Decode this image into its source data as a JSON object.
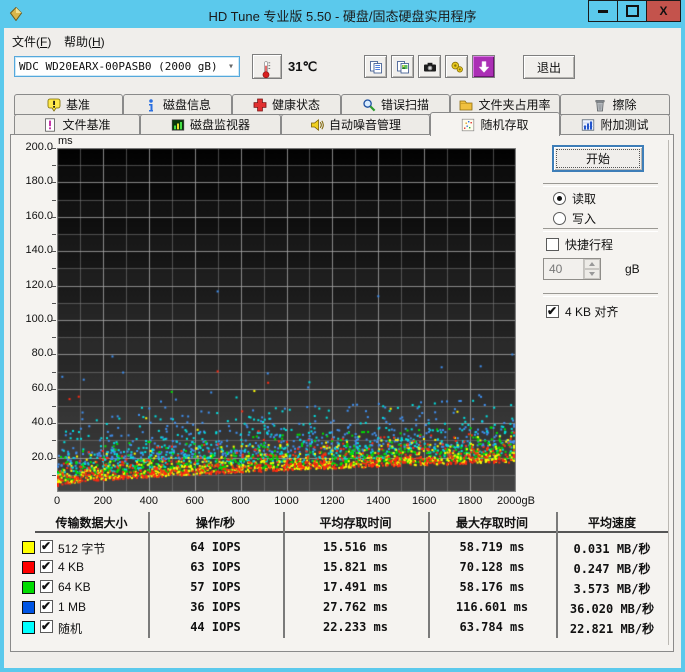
{
  "window": {
    "title": "HD Tune 专业版 5.50 - 硬盘/固态硬盘实用程序",
    "close_label": "X"
  },
  "menu": {
    "items": [
      {
        "label": "文件(F)"
      },
      {
        "label": "帮助(H)"
      }
    ]
  },
  "toolbar": {
    "drive": "WDC WD20EARX-00PASB0  (2000 gB)",
    "temperature": "31℃",
    "exit": "退出"
  },
  "tabs": {
    "row1": [
      {
        "label": "基准"
      },
      {
        "label": "磁盘信息"
      },
      {
        "label": "健康状态"
      },
      {
        "label": "错误扫描"
      },
      {
        "label": "文件夹占用率"
      },
      {
        "label": "擦除"
      }
    ],
    "row2": [
      {
        "label": "文件基准"
      },
      {
        "label": "磁盘监视器"
      },
      {
        "label": "自动噪音管理"
      },
      {
        "label": "随机存取"
      },
      {
        "label": "附加测试"
      }
    ],
    "active": "随机存取"
  },
  "panel": {
    "start": "开始",
    "read": "读取",
    "write": "写入",
    "read_selected": true,
    "write_selected": false,
    "short_stroke": "快捷行程",
    "short_stroke_checked": false,
    "short_stroke_value": "40",
    "short_stroke_unit": "gB",
    "align": "4 KB 对齐",
    "align_checked": true
  },
  "chart_data": {
    "type": "scatter",
    "ylabel": "ms",
    "x_axis_unit": "gB",
    "xlim": [
      0,
      2000
    ],
    "ylim": [
      0,
      200
    ],
    "x_label_step": 200,
    "x_grid_step": 100,
    "y_label_step": 20,
    "y_grid_step": 10,
    "grid": true,
    "background": "black-gradient",
    "envelope": {
      "base": 3.0,
      "rise": 14.0,
      "power": 0.62
    },
    "series": [
      {
        "name": "512 字节",
        "color": "#FFFF00",
        "z": 4,
        "count": 680,
        "offset": 0.5,
        "scale": 4.2,
        "tail_frac": 0.008,
        "tail_max": 50,
        "outliers": [
          [
            860,
            58.7
          ]
        ]
      },
      {
        "name": "4 KB",
        "color": "#FF2A12",
        "z": 5,
        "count": 680,
        "offset": 0.2,
        "scale": 4.8,
        "tail_frac": 0.012,
        "tail_max": 62,
        "outliers": [
          [
            700,
            70.1
          ],
          [
            920,
            63.5
          ]
        ]
      },
      {
        "name": "64 KB",
        "color": "#00E000",
        "z": 3,
        "count": 660,
        "offset": 2.2,
        "scale": 5.2,
        "tail_frac": 0.01,
        "tail_max": 54,
        "outliers": [
          [
            500,
            58.2
          ]
        ]
      },
      {
        "name": "1 MB",
        "color": "#3F8FEF",
        "z": 1,
        "count": 540,
        "offset": 10,
        "scale": 7.5,
        "tail_frac": 0.05,
        "tail_max": 80,
        "outliers": [
          [
            700,
            116.6
          ],
          [
            1400,
            113.8
          ]
        ]
      },
      {
        "name": "随机",
        "color": "#00E0E0",
        "z": 2,
        "count": 540,
        "offset": 5,
        "scale": 8.5,
        "tail_frac": 0.03,
        "tail_max": 60,
        "outliers": [
          [
            1100,
            63.8
          ]
        ]
      }
    ]
  },
  "table": {
    "headers": [
      "传输数据大小",
      "操作/秒",
      "平均存取时间",
      "最大存取时间",
      "平均速度"
    ],
    "rows": [
      {
        "color": "#FFFF00",
        "checked": true,
        "label": "512 字节",
        "ops": "64 IOPS",
        "avg": "15.516 ms",
        "max": "58.719 ms",
        "speed": "0.031 MB/秒"
      },
      {
        "color": "#FF0000",
        "checked": true,
        "label": "4 KB",
        "ops": "63 IOPS",
        "avg": "15.821 ms",
        "max": "70.128 ms",
        "speed": "0.247 MB/秒"
      },
      {
        "color": "#00DC00",
        "checked": true,
        "label": "64 KB",
        "ops": "57 IOPS",
        "avg": "17.491 ms",
        "max": "58.176 ms",
        "speed": "3.573 MB/秒"
      },
      {
        "color": "#0055E5",
        "checked": true,
        "label": "1 MB",
        "ops": "36 IOPS",
        "avg": "27.762 ms",
        "max": "116.601 ms",
        "speed": "36.020 MB/秒"
      },
      {
        "color": "#00FFFF",
        "checked": true,
        "label": "随机",
        "ops": "44 IOPS",
        "avg": "22.233 ms",
        "max": "63.784 ms",
        "speed": "22.821 MB/秒"
      }
    ]
  }
}
